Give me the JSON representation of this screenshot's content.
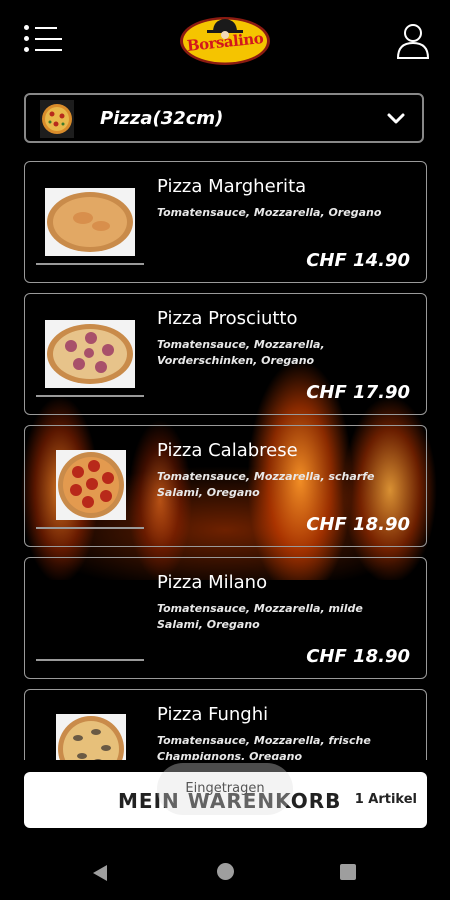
{
  "app": {
    "logo_text": "Borsalino"
  },
  "category": {
    "label": "Pizza(32cm)"
  },
  "products": [
    {
      "name": "Pizza Margherita",
      "description": "Tomatensauce, Mozzarella, Oregano",
      "price": "CHF 14.90"
    },
    {
      "name": "Pizza Prosciutto",
      "description": "Tomatensauce, Mozzarella, Vorderschinken, Oregano",
      "price": "CHF 17.90"
    },
    {
      "name": "Pizza Calabrese",
      "description": "Tomatensauce, Mozzarella, scharfe Salami, Oregano",
      "price": "CHF 18.90"
    },
    {
      "name": "Pizza Milano",
      "description": "Tomatensauce, Mozzarella, milde Salami, Oregano",
      "price": "CHF 18.90"
    },
    {
      "name": "Pizza Funghi",
      "description": "Tomatensauce, Mozzarella, frische Champignons, Oregano",
      "price": ""
    }
  ],
  "cart": {
    "label": "MEIN WARENKORB",
    "count": "1 Artikel"
  },
  "toast": {
    "text": "Eingetragen"
  },
  "icons": [
    "menu-icon",
    "user-icon",
    "chevron-down-icon",
    "back-icon",
    "home-icon",
    "recent-apps-icon"
  ],
  "colors": {
    "background": "#000000",
    "brand_red": "#d2181d",
    "brand_yellow": "#f5c400",
    "card_border": "#9a9a9a"
  }
}
